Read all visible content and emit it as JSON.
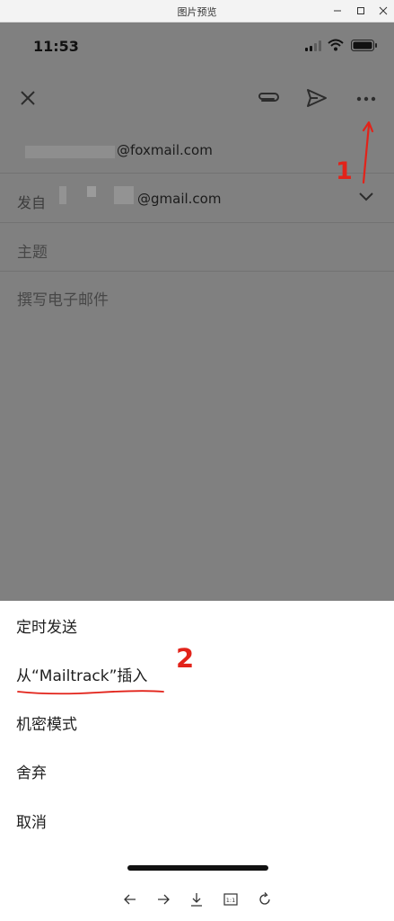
{
  "window": {
    "title": "图片预览"
  },
  "status_bar": {
    "time": "11:53"
  },
  "compose": {
    "to_suffix": "@foxmail.com",
    "from_label": "发自",
    "from_suffix": "@gmail.com",
    "subject_placeholder": "主题",
    "body_placeholder": "撰写电子邮件"
  },
  "annotations": {
    "step1": "1",
    "step2": "2",
    "color": "#e2231a"
  },
  "menu": {
    "items": [
      "定时发送",
      "从“Mailtrack”插入",
      "机密模式",
      "舍弃",
      "取消"
    ]
  },
  "viewer_toolbar": {
    "icons": [
      "arrow-left-icon",
      "arrow-right-icon",
      "download-icon",
      "actual-size-icon",
      "rotate-icon"
    ],
    "actual_size_label": "1:1"
  }
}
